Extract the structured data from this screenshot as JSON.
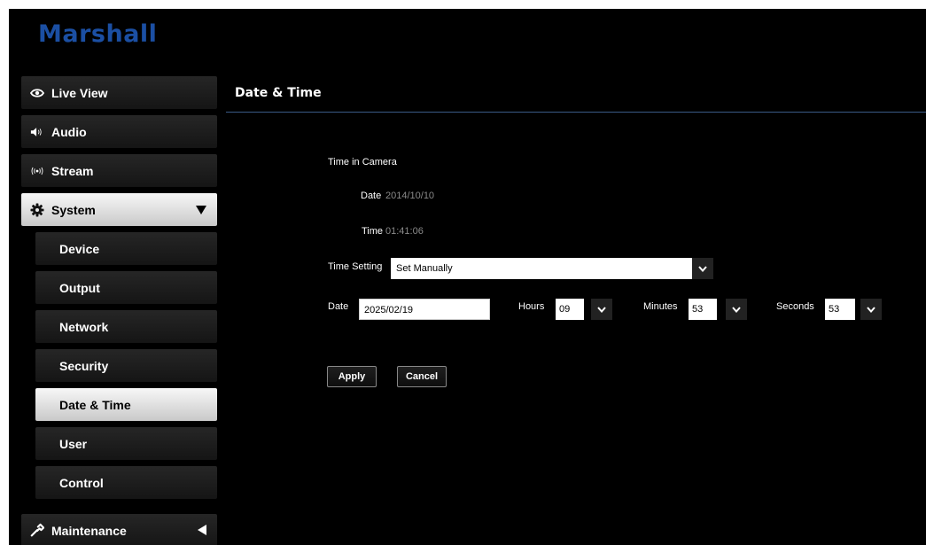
{
  "brand": {
    "logo_text": "Marshall",
    "color": "#1b4fa3"
  },
  "sidebar": {
    "items": [
      {
        "label": "Live View",
        "icon": "eye-icon"
      },
      {
        "label": "Audio",
        "icon": "speaker-icon"
      },
      {
        "label": "Stream",
        "icon": "broadcast-icon"
      },
      {
        "label": "System",
        "icon": "gear-icon",
        "expanded": true
      },
      {
        "label": "Device"
      },
      {
        "label": "Output"
      },
      {
        "label": "Network"
      },
      {
        "label": "Security"
      },
      {
        "label": "Date & Time",
        "selected": true
      },
      {
        "label": "User"
      },
      {
        "label": "Control"
      },
      {
        "label": "Maintenance",
        "icon": "wrench-icon",
        "expanded": false
      }
    ]
  },
  "main": {
    "title": "Date & Time",
    "time_in_camera": {
      "heading": "Time in Camera",
      "date_label": "Date",
      "date_value": "2014/10/10",
      "time_label": "Time",
      "time_value": "01:41:06"
    },
    "time_setting": {
      "label": "Time Setting",
      "value": "Set Manually"
    },
    "manual": {
      "date_label": "Date",
      "date_value": "2025/02/19",
      "hours_label": "Hours",
      "hours_value": "09",
      "minutes_label": "Minutes",
      "minutes_value": "53",
      "seconds_label": "Seconds",
      "seconds_value": "53"
    },
    "buttons": {
      "apply": "Apply",
      "cancel": "Cancel"
    }
  }
}
